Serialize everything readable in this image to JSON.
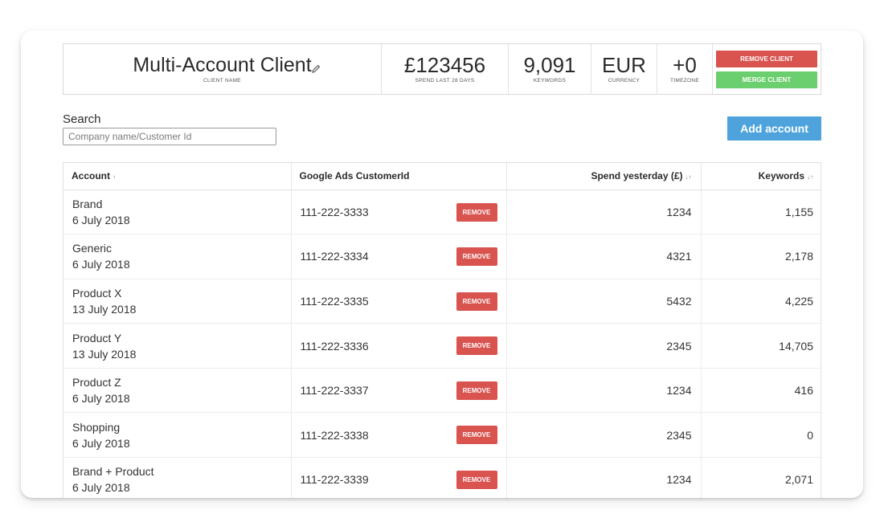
{
  "header": {
    "client_name": "Multi-Account Client",
    "client_name_label": "CLIENT NAME",
    "spend": "£123456",
    "spend_label": "SPEND LAST 28 DAYS",
    "keywords": "9,091",
    "keywords_label": "KEYWORDS",
    "currency": "EUR",
    "currency_label": "CURRENCY",
    "timezone": "+0",
    "timezone_label": "TIMEZONE",
    "remove_client_label": "REMOVE CLIENT",
    "merge_client_label": "MERGE CLIENT"
  },
  "search": {
    "label": "Search",
    "placeholder": "Company name/Customer Id",
    "value": ""
  },
  "add_account_label": "Add account",
  "table": {
    "columns": {
      "account": "Account",
      "customer_id": "Google Ads CustomerId",
      "spend": "Spend yesterday (£)",
      "keywords": "Keywords"
    },
    "remove_label": "REMOVE",
    "rows": [
      {
        "name": "Brand",
        "date": "6 July 2018",
        "cid": "111-222-3333",
        "spend": "1234",
        "keywords": "1,155"
      },
      {
        "name": "Generic",
        "date": "6 July 2018",
        "cid": "111-222-3334",
        "spend": "4321",
        "keywords": "2,178"
      },
      {
        "name": "Product X",
        "date": "13 July 2018",
        "cid": "111-222-3335",
        "spend": "5432",
        "keywords": "4,225"
      },
      {
        "name": "Product Y",
        "date": "13 July 2018",
        "cid": "111-222-3336",
        "spend": "2345",
        "keywords": "14,705"
      },
      {
        "name": "Product Z",
        "date": "6 July 2018",
        "cid": "111-222-3337",
        "spend": "1234",
        "keywords": "416"
      },
      {
        "name": "Shopping",
        "date": "6 July 2018",
        "cid": "111-222-3338",
        "spend": "2345",
        "keywords": "0"
      },
      {
        "name": "Brand + Product",
        "date": "6 July 2018",
        "cid": "111-222-3339",
        "spend": "1234",
        "keywords": "2,071"
      }
    ]
  },
  "colors": {
    "remove": "#d9534f",
    "merge": "#6ccf6f",
    "add": "#4ea3dc"
  }
}
